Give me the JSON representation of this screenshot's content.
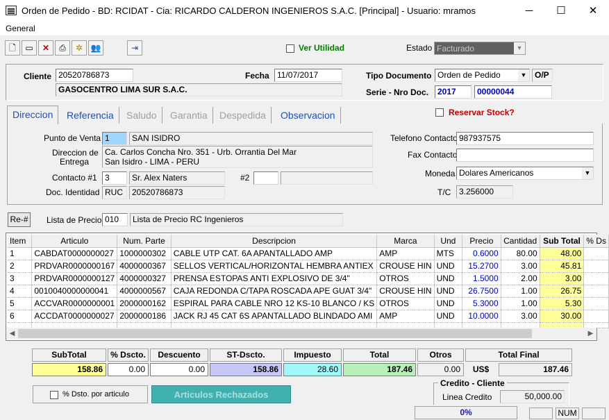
{
  "window": {
    "title": "Orden de Pedido - BD: RCIDAT - Cia: RICARDO CALDERON INGENIEROS S.A.C. [Principal] - Usuario: mramos",
    "minimize": "─",
    "maximize": "☐",
    "close": "✕"
  },
  "menu": {
    "general": "General"
  },
  "toolbar": {
    "icons": [
      "new-document-icon",
      "save-icon",
      "delete-icon",
      "print-icon",
      "settings-icon",
      "users-icon",
      "exit-icon"
    ],
    "ver_utilidad": "Ver Utilidad",
    "estado_label": "Estado",
    "estado_value": "Facturado"
  },
  "header": {
    "cliente_label": "Cliente",
    "cliente_code": "20520786873",
    "cliente_name": "GASOCENTRO LIMA SUR S.A.C.",
    "fecha_label": "Fecha",
    "fecha_value": "11/07/2017",
    "tipo_doc_label": "Tipo Documento",
    "tipo_doc_value": "Orden de Pedido",
    "tipo_doc_code": "O/P",
    "serie_label": "Serie - Nro Doc.",
    "serie_value": "2017",
    "nro_doc_value": "00000044"
  },
  "tabs": [
    "Direccion",
    "Referencia",
    "Saludo",
    "Garantia",
    "Despedida",
    "Observacion"
  ],
  "reservar_stock": "Reservar Stock?",
  "direccion": {
    "punto_venta_label": "Punto de Venta",
    "punto_venta_code": "1",
    "punto_venta_name": "SAN ISIDRO",
    "direccion_label_1": "Direccion de",
    "direccion_label_2": "Entrega",
    "direccion_line1": "Ca. Carlos Concha Nro. 351 - Urb. Orrantia Del Mar",
    "direccion_line2": "San Isidro - LIMA - PERU",
    "contacto_label": "Contacto  #1",
    "contacto_num": "3",
    "contacto_name": "Sr. Alex Naters",
    "contacto2_label": "#2",
    "doc_identidad_label": "Doc. Identidad",
    "doc_tipo": "RUC",
    "doc_numero": "20520786873",
    "telefono_label": "Telefono Contacto",
    "telefono_value": "987937575",
    "fax_label": "Fax Contacto",
    "fax_value": "",
    "moneda_label": "Moneda",
    "moneda_value": "Dolares Americanos",
    "tc_label": "T/C",
    "tc_value": "3.256000"
  },
  "lista_precio": {
    "rebtn": "Re-#",
    "label": "Lista de Precio",
    "code": "010",
    "name": "Lista de Precio RC Ingenieros"
  },
  "grid": {
    "columns": [
      "Item",
      "Articulo",
      "Num. Parte",
      "Descripcion",
      "Marca",
      "Und",
      "Precio",
      "Cantidad",
      "Sub Total",
      "% Ds"
    ],
    "rows": [
      [
        "1",
        "CABDAT0000000027",
        "1000000302",
        "CABLE UTP  CAT. 6A  APANTALLADO AMP",
        "AMP",
        "MTS",
        "0.6000",
        "80.00",
        "48.00"
      ],
      [
        "2",
        "PRDVAR0000000167",
        "4000000367",
        "SELLOS VERTICAL/HORIZONTAL HEMBRA  ANTIEX",
        "CROUSE HIN",
        "UND",
        "15.2700",
        "3.00",
        "45.81"
      ],
      [
        "3",
        "PRDVAR0000000127",
        "4000000327",
        "PRENSA ESTOPAS ANTI EXPLOSIVO DE 3/4\"",
        "OTROS",
        "UND",
        "1.5000",
        "2.00",
        "3.00"
      ],
      [
        "4",
        "0010040000000041",
        "4000000567",
        "CAJA REDONDA C/TAPA ROSCADA APE GUAT 3/4\"",
        "CROUSE HIN",
        "UND",
        "26.7500",
        "1.00",
        "26.75"
      ],
      [
        "5",
        "ACCVAR0000000001",
        "2000000162",
        "ESPIRAL PARA CABLE NRO 12 KS-10 BLANCO / KS",
        "OTROS",
        "UND",
        "5.3000",
        "1.00",
        "5.30"
      ],
      [
        "6",
        "ACCDAT0000000027",
        "2000000186",
        "JACK RJ 45 CAT 6S  APANTALLADO  BLINDADO AMI",
        "AMP",
        "UND",
        "10.0000",
        "3.00",
        "30.00"
      ]
    ]
  },
  "totals": {
    "subtotal_label": "SubTotal",
    "subtotal": "158.86",
    "pct_dscto_label": "% Dscto.",
    "pct_dscto": "0.00",
    "descuento_label": "Descuento",
    "descuento": "0.00",
    "st_dscto_label": "ST-Dscto.",
    "st_dscto": "158.86",
    "impuesto_label": "Impuesto",
    "impuesto": "28.60",
    "total_label": "Total",
    "total": "187.46",
    "otros_label": "Otros",
    "otros": "0.00",
    "total_final_label": "Total Final",
    "currency": "US$",
    "total_final": "187.46"
  },
  "footer": {
    "dscto_articulo": "% Dsto. por articulo",
    "rechazados": "Articulos Rechazados",
    "credito_title": "Credito - Cliente",
    "linea_credito_label": "Linea Credito",
    "linea_credito": "50,000.00",
    "progress": "0%",
    "num": "NUM"
  },
  "colors": {
    "subtotal_bg": "#ffff99",
    "st_dscto_bg": "#c8c8f8",
    "impuesto_bg": "#a0f8f8",
    "total_bg": "#b8f0b8",
    "rechazados_bg": "#40b0b0",
    "link_blue": "#1a4fb8",
    "green": "#008000",
    "red": "#c00000"
  }
}
